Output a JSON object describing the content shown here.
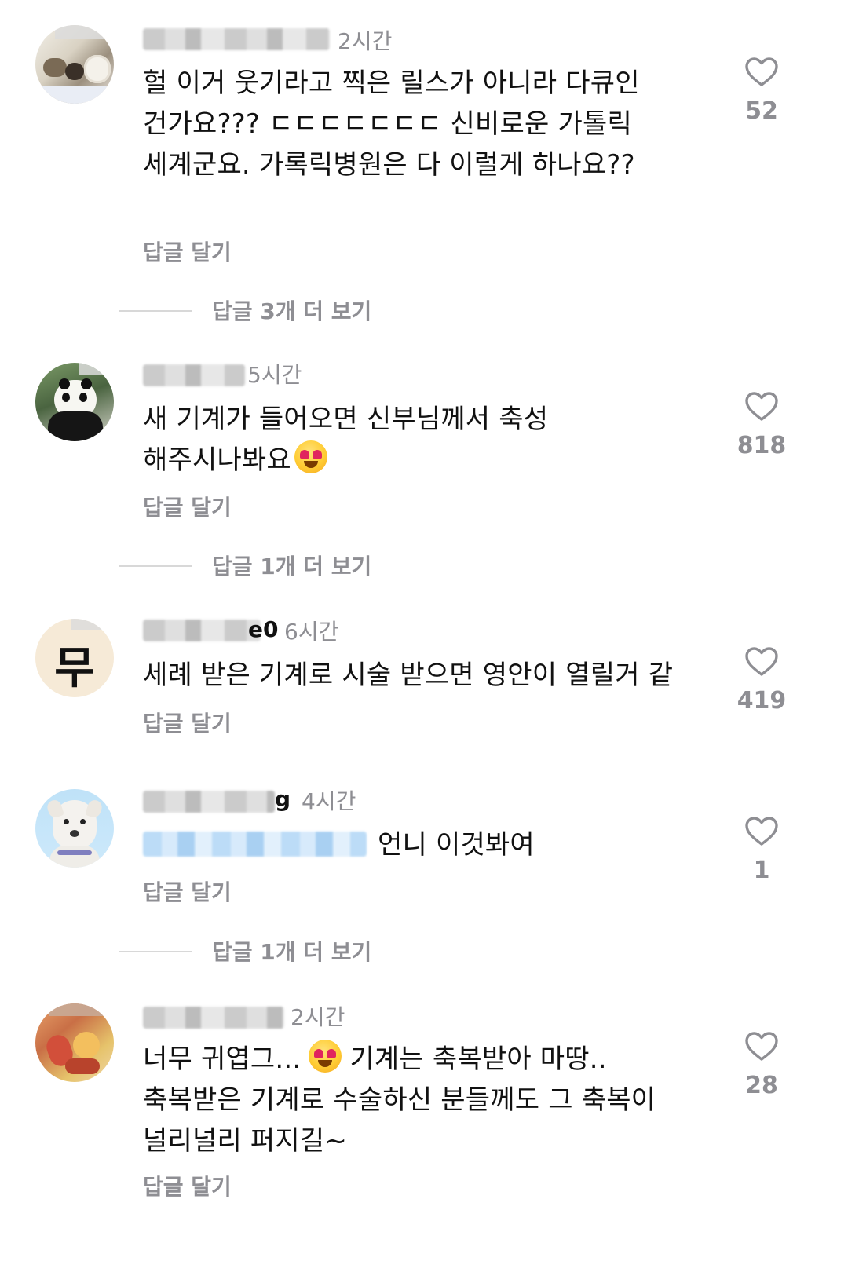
{
  "comments": [
    {
      "username_suffix": "",
      "timestamp": "2시간",
      "text": "헐 이거 웃기라고 찍은 릴스가 아니라 다큐인건가요??? ㄷㄷㄷㄷㄷㄷㄷ 신비로운 가톨릭세계군요. 가록릭병원은 다 이럴게 하나요??",
      "likes": "52",
      "reply_label": "답글 달기",
      "more_replies": "답글 3개 더 보기"
    },
    {
      "username_suffix": "",
      "timestamp": "5시간",
      "text_before_emoji": "새 기계가 들어오면 신부님께서 축성해주시나봐요",
      "likes": "818",
      "reply_label": "답글 달기",
      "more_replies": "답글 1개 더 보기"
    },
    {
      "avatar_text": "무",
      "username_suffix": "e0",
      "timestamp": "6시간",
      "text": "세례 받은 기계로 시술 받으면 영안이 열릴거 같",
      "likes": "419",
      "reply_label": "답글 달기"
    },
    {
      "username_suffix": "g",
      "timestamp": "4시간",
      "text": "언니 이것봐여",
      "likes": "1",
      "reply_label": "답글 달기",
      "more_replies": "답글 1개 더 보기"
    },
    {
      "username_suffix": "",
      "timestamp": "2시간",
      "text_before_emoji": "너무 귀엽그...",
      "text_after_emoji": "기계는 축복받아 마땅..",
      "text_line2": "축복받은 기계로 수술하신 분들께도 그 축복이",
      "text_line3": "널리널리 퍼지길~",
      "likes": "28",
      "reply_label": "답글 달기"
    }
  ],
  "colors": {
    "text": "#111111",
    "muted": "#8e8e93",
    "heart": "#8e8e93",
    "divider": "#d8d8d8"
  },
  "icons": {
    "like": "heart-outline-icon",
    "emoji": "heart-eyes-emoji"
  }
}
